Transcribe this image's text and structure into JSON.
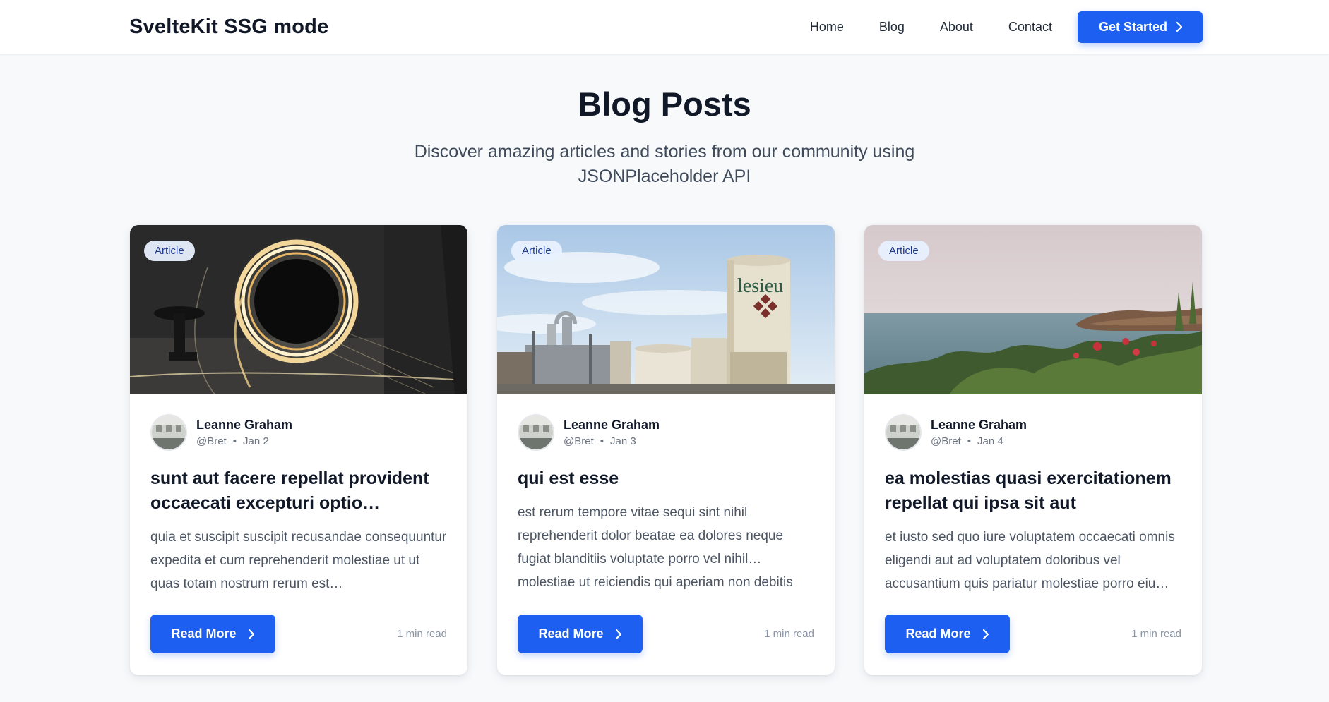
{
  "header": {
    "brand": "SvelteKit SSG mode",
    "nav": [
      "Home",
      "Blog",
      "About",
      "Contact"
    ],
    "cta_label": "Get Started"
  },
  "hero": {
    "title": "Blog Posts",
    "subtitle": "Discover amazing articles and stories from our community using JSONPlaceholder API"
  },
  "posts": [
    {
      "tag": "Article",
      "author": "Leanne Graham",
      "handle": "@Bret",
      "date": "Jan 2",
      "title": "sunt aut facere repellat provident occaecati excepturi optio…",
      "excerpt": "quia et suscipit suscipit recusandae consequuntur expedita et cum reprehenderit molestiae ut ut quas totam nostrum rerum est…",
      "read_more": "Read More",
      "read_time": "1 min read"
    },
    {
      "tag": "Article",
      "author": "Leanne Graham",
      "handle": "@Bret",
      "date": "Jan 3",
      "title": "qui est esse",
      "excerpt": "est rerum tempore vitae sequi sint nihil reprehenderit dolor beatae ea dolores neque fugiat blanditiis voluptate porro vel nihil… molestiae ut reiciendis qui aperiam non debitis",
      "read_more": "Read More",
      "read_time": "1 min read"
    },
    {
      "tag": "Article",
      "author": "Leanne Graham",
      "handle": "@Bret",
      "date": "Jan 4",
      "title": "ea molestias quasi exercitationem repellat qui ipsa sit aut",
      "excerpt": "et iusto sed quo iure voluptatem occaecati omnis eligendi aut ad voluptatem doloribus vel accusantium quis pariatur molestiae porro eiu…",
      "read_more": "Read More",
      "read_time": "1 min read"
    }
  ],
  "images": {
    "logo_on_tank": "lesieu"
  },
  "colors": {
    "accent": "#1d5ff0",
    "page_bg": "#f7f9fb",
    "tag_bg": "#e8f0fe"
  }
}
